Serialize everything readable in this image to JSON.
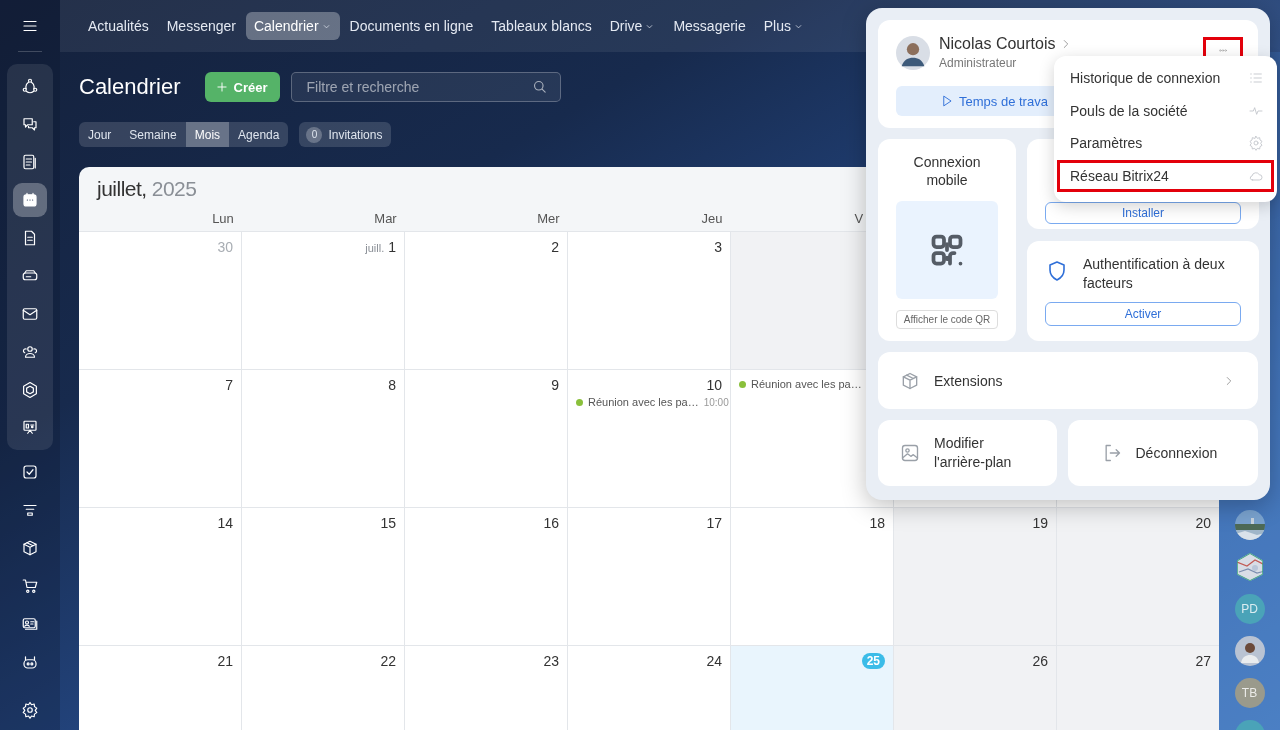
{
  "sidebar": {
    "pinned": [
      {
        "selected": false
      },
      {
        "selected": false
      },
      {
        "selected": false
      },
      {
        "selected": true
      },
      {
        "selected": false
      },
      {
        "selected": false
      },
      {
        "selected": false
      },
      {
        "selected": false
      },
      {
        "selected": false
      },
      {
        "selected": false
      }
    ],
    "items": [
      {
        "selected": false
      },
      {
        "selected": false
      },
      {
        "selected": false
      },
      {
        "selected": false
      },
      {
        "selected": false
      },
      {
        "selected": false
      }
    ]
  },
  "nav": [
    {
      "label": "Actualités",
      "selected": false,
      "dropdown": false
    },
    {
      "label": "Messenger",
      "selected": false,
      "dropdown": false
    },
    {
      "label": "Calendrier",
      "selected": true,
      "dropdown": true
    },
    {
      "label": "Documents en ligne",
      "selected": false,
      "dropdown": false
    },
    {
      "label": "Tableaux blancs",
      "selected": false,
      "dropdown": false
    },
    {
      "label": "Drive",
      "selected": false,
      "dropdown": true
    },
    {
      "label": "Messagerie",
      "selected": false,
      "dropdown": false
    },
    {
      "label": "Plus",
      "selected": false,
      "dropdown": true
    }
  ],
  "page": {
    "title": "Calendrier",
    "create_button": "Créer",
    "search": {
      "placeholder": "Filtre et recherche"
    }
  },
  "views": [
    {
      "label": "Jour",
      "selected": false
    },
    {
      "label": "Semaine",
      "selected": false
    },
    {
      "label": "Mois",
      "selected": true
    },
    {
      "label": "Agenda",
      "selected": false
    }
  ],
  "invitations": {
    "count": "0",
    "label": "Invitations"
  },
  "calendar": {
    "month": "juillet,",
    "year": "2025",
    "weekdays": [
      "Lun",
      "Mar",
      "Mer",
      "Jeu",
      "V"
    ],
    "weeks": [
      {
        "days": [
          {
            "day": "30",
            "muted": true
          },
          {
            "day": "1",
            "month_prefix": "juill."
          },
          {
            "day": "2"
          },
          {
            "day": "3"
          },
          {
            "shaded": true
          }
        ]
      },
      {
        "days": [
          {
            "day": "7"
          },
          {
            "day": "8"
          },
          {
            "day": "9"
          },
          {
            "day": "10",
            "events": [
              {
                "title": "Réunion avec les pa…",
                "time": "10:00",
                "color": "#8ac03b"
              }
            ]
          },
          {
            "events": [
              {
                "title": "Réunion avec les pa…",
                "color": "#8ac03b"
              }
            ]
          }
        ]
      },
      {
        "days": [
          {
            "day": "14"
          },
          {
            "day": "15"
          },
          {
            "day": "16"
          },
          {
            "day": "17"
          },
          {
            "day": "18"
          },
          {
            "day": "19",
            "shaded": true
          },
          {
            "day": "20",
            "shaded": true
          }
        ]
      },
      {
        "days": [
          {
            "day": "21"
          },
          {
            "day": "22"
          },
          {
            "day": "23"
          },
          {
            "day": "24"
          },
          {
            "day": "25",
            "today": true
          },
          {
            "day": "26",
            "shaded": true
          },
          {
            "day": "27",
            "shaded": true
          }
        ]
      }
    ]
  },
  "rail": [
    {
      "kind": "picture"
    },
    {
      "kind": "hexagon"
    },
    {
      "kind": "initials",
      "text": "PD",
      "color": "#4aa3b8"
    },
    {
      "kind": "person"
    },
    {
      "kind": "initials",
      "text": "TB",
      "color": "#9a9a8c"
    },
    {
      "kind": "initials",
      "color": "#4aa3b8"
    }
  ],
  "profile": {
    "name": "Nicolas Courtois",
    "role": "Administrateur",
    "more_highlighted": true,
    "worktime_button": "Temps de trava"
  },
  "menu": [
    {
      "label": "Historique de connexion",
      "highlighted": false
    },
    {
      "label": "Pouls de la société",
      "highlighted": false
    },
    {
      "label": "Paramètres",
      "highlighted": false
    },
    {
      "label": "Réseau Bitrix24",
      "highlighted": true
    }
  ],
  "mobile": {
    "title": "Connexion mobile",
    "button": "Afficher le code QR"
  },
  "install": {
    "button": "Installer"
  },
  "two_factor": {
    "title": "Authentification à deux facteurs",
    "button": "Activer"
  },
  "extensions": {
    "label": "Extensions"
  },
  "actions": [
    {
      "label": "Modifier l'arrière-plan"
    },
    {
      "label": "Déconnexion"
    }
  ]
}
